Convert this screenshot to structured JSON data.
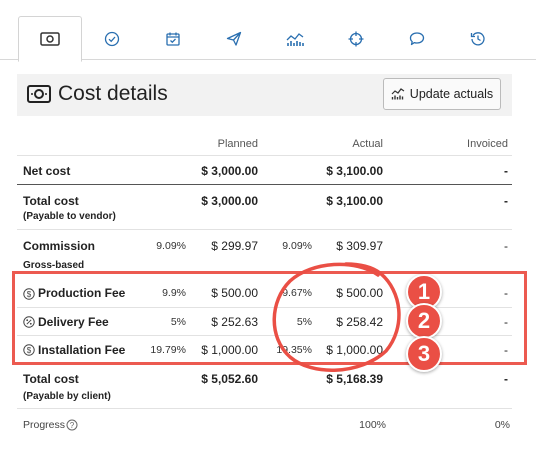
{
  "tabs": [
    {
      "name": "cost-details",
      "icon": "money-icon",
      "active": true
    },
    {
      "name": "approval",
      "icon": "check-circle-icon",
      "active": false
    },
    {
      "name": "schedule",
      "icon": "calendar-check-icon",
      "active": false
    },
    {
      "name": "send",
      "icon": "paper-plane-icon",
      "active": false
    },
    {
      "name": "analytics",
      "icon": "chart-icon",
      "active": false
    },
    {
      "name": "targeting",
      "icon": "crosshair-icon",
      "active": false
    },
    {
      "name": "comments",
      "icon": "speech-bubble-icon",
      "active": false
    },
    {
      "name": "history",
      "icon": "history-icon",
      "active": false
    }
  ],
  "header": {
    "title": "Cost details",
    "update_button": "Update actuals"
  },
  "columns": {
    "planned": "Planned",
    "actual": "Actual",
    "invoiced": "Invoiced"
  },
  "rows": {
    "net_cost": {
      "label": "Net cost",
      "planned": "$ 3,000.00",
      "actual": "$ 3,100.00",
      "invoiced": "-"
    },
    "total_cost_vendor": {
      "label": "Total cost",
      "sub": "(Payable to vendor)",
      "planned": "$ 3,000.00",
      "actual": "$ 3,100.00",
      "invoiced": "-"
    },
    "commission": {
      "label": "Commission",
      "sub": "Gross-based",
      "planned_pct": "9.09%",
      "planned": "$ 299.97",
      "actual_pct": "9.09%",
      "actual": "$ 309.97",
      "invoiced": "-"
    },
    "total_cost_client": {
      "label": "Total cost",
      "sub": "(Payable by client)",
      "planned": "$ 5,052.60",
      "actual": "$ 5,168.39",
      "invoiced": "-"
    }
  },
  "fees": [
    {
      "label": "Production Fee",
      "icon": "dollar-circle-icon",
      "planned_pct": "9.9%",
      "planned": "$ 500.00",
      "actual_pct": "9.67%",
      "actual": "$ 500.00",
      "invoiced": "-",
      "badge": "1"
    },
    {
      "label": "Delivery Fee",
      "icon": "percent-circle-icon",
      "planned_pct": "5%",
      "planned": "$ 252.63",
      "actual_pct": "5%",
      "actual": "$ 258.42",
      "invoiced": "-",
      "badge": "2"
    },
    {
      "label": "Installation Fee",
      "icon": "dollar-circle-icon",
      "planned_pct": "19.79%",
      "planned": "$ 1,000.00",
      "actual_pct": "19.35%",
      "actual": "$ 1,000.00",
      "invoiced": "-",
      "badge": "3"
    }
  ],
  "progress": {
    "label": "Progress",
    "actual": "100%",
    "invoiced": "0%"
  },
  "colors": {
    "accent": "#2a6fb0",
    "highlight": "#ec5a50"
  }
}
